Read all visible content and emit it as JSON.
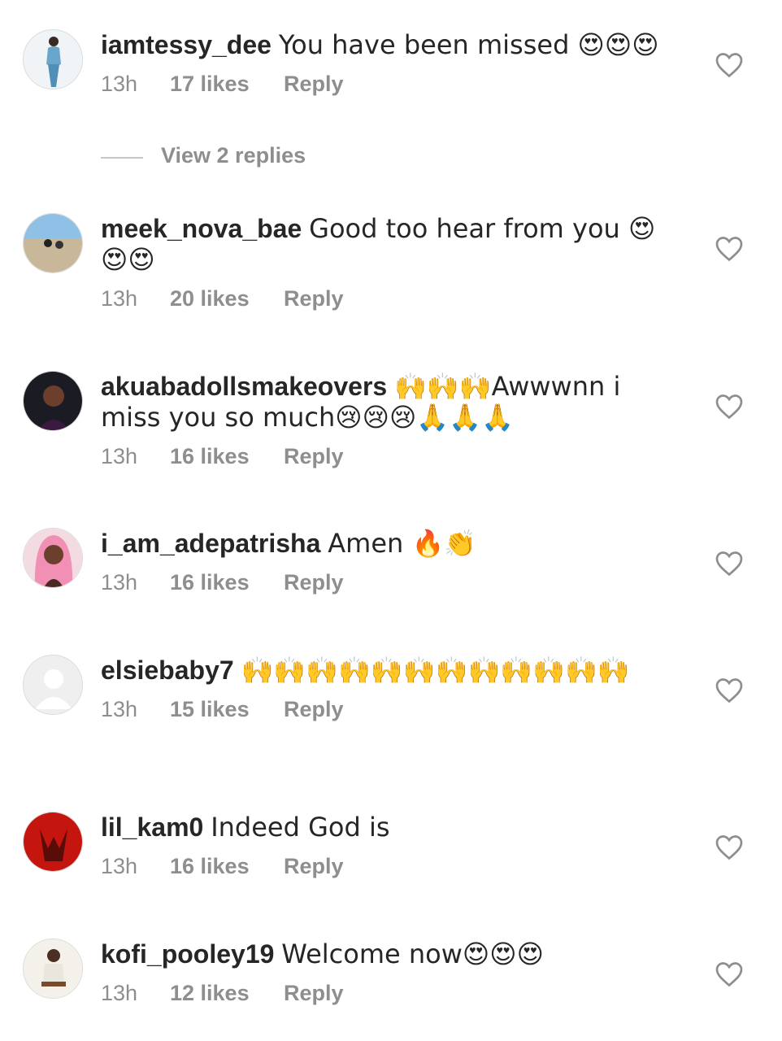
{
  "comments": [
    {
      "user": "iamtessy_dee",
      "text": "You have been missed 😍😍😍",
      "time": "13h",
      "likes": "17 likes",
      "reply": "Reply"
    },
    {
      "user": "meek_nova_bae",
      "text": "Good too hear from you 😍😍😍",
      "time": "13h",
      "likes": "20 likes",
      "reply": "Reply"
    },
    {
      "user": "akuabadollsmakeovers",
      "text": "🙌🙌🙌Awwwnn i miss you so much😢😢😢🙏🙏🙏",
      "time": "13h",
      "likes": "16 likes",
      "reply": "Reply"
    },
    {
      "user": "i_am_adepatrisha",
      "text": "Amen 🔥👏",
      "time": "13h",
      "likes": "16 likes",
      "reply": "Reply"
    },
    {
      "user": "elsiebaby7",
      "text": "🙌🙌🙌🙌🙌🙌🙌🙌🙌🙌🙌🙌",
      "time": "13h",
      "likes": "15 likes",
      "reply": "Reply"
    },
    {
      "user": "lil_kam0",
      "text": "Indeed God is",
      "time": "13h",
      "likes": "16 likes",
      "reply": "Reply"
    },
    {
      "user": "kofi_pooley19",
      "text": "Welcome now😍😍😍",
      "time": "13h",
      "likes": "12 likes",
      "reply": "Reply"
    }
  ],
  "view_replies": "View 2 replies",
  "icons": {
    "like": "heart-outline-icon",
    "avatar_placeholder": "default-avatar-icon"
  }
}
